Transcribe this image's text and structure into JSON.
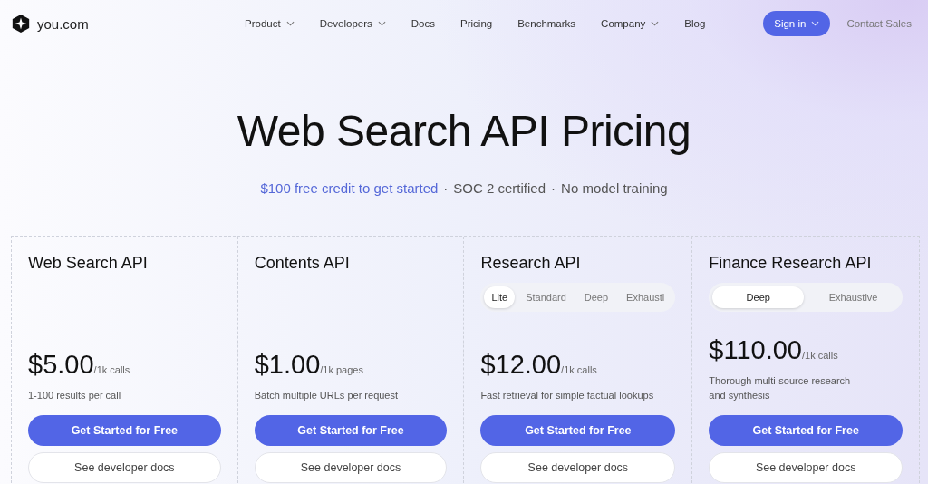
{
  "brand": {
    "name": "you.com"
  },
  "nav": [
    {
      "label": "Product",
      "dropdown": true
    },
    {
      "label": "Developers",
      "dropdown": true
    },
    {
      "label": "Docs",
      "dropdown": false
    },
    {
      "label": "Pricing",
      "dropdown": false
    },
    {
      "label": "Benchmarks",
      "dropdown": false
    },
    {
      "label": "Company",
      "dropdown": true
    },
    {
      "label": "Blog",
      "dropdown": false
    }
  ],
  "sign_in": {
    "label": "Sign in"
  },
  "contact": {
    "label": "Contact Sales"
  },
  "title": "Web Search API Pricing",
  "subtitle": [
    {
      "text": "$100 free credit to get started",
      "kind": "link"
    },
    {
      "text": "·",
      "kind": "sep"
    },
    {
      "text": "SOC 2 certified",
      "kind": "text"
    },
    {
      "text": "·",
      "kind": "sep"
    },
    {
      "text": "No model training",
      "kind": "text"
    }
  ],
  "plans": [
    {
      "name": "Web Search API",
      "price": "$5.00",
      "unit": "/1k calls",
      "description": "1-100 results per call",
      "primary": "Get Started for Free",
      "secondary": "See developer docs"
    },
    {
      "name": "Contents API",
      "price": "$1.00",
      "unit": "/1k pages",
      "description": "Batch multiple URLs per request",
      "primary": "Get Started for Free",
      "secondary": "See developer docs"
    },
    {
      "name": "Research API",
      "tiers": [
        {
          "label": "Lite",
          "selected": true
        },
        {
          "label": "Standard",
          "selected": false
        },
        {
          "label": "Deep",
          "selected": false
        },
        {
          "label": "Exhausti",
          "selected": false
        }
      ],
      "price": "$12.00",
      "unit": "/1k calls",
      "description": "Fast retrieval for simple factual lookups",
      "primary": "Get Started for Free",
      "secondary": "See developer docs"
    },
    {
      "name": "Finance Research API",
      "tiers": [
        {
          "label": "Deep",
          "selected": true
        },
        {
          "label": "Exhaustive",
          "selected": false
        }
      ],
      "price": "$110.00",
      "unit": "/1k calls",
      "description": "Thorough multi-source research and synthesis",
      "primary": "Get Started for Free",
      "secondary": "See developer docs"
    }
  ]
}
